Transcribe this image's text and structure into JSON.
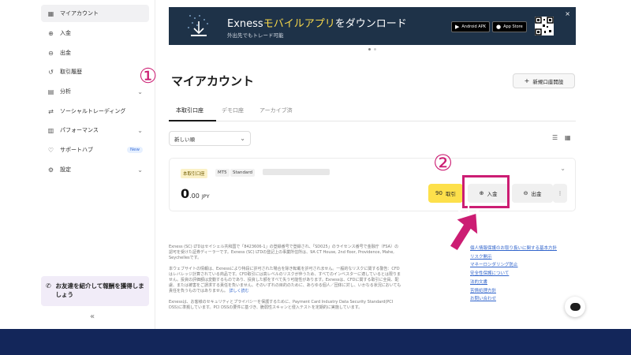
{
  "sidebar": {
    "items": [
      {
        "label": "マイアカウント",
        "icon": "grid-icon"
      },
      {
        "label": "入金",
        "icon": "plus-circle-icon"
      },
      {
        "label": "出金",
        "icon": "minus-circle-icon"
      },
      {
        "label": "取引履歴",
        "icon": "history-icon"
      },
      {
        "label": "分析",
        "icon": "analytics-icon"
      },
      {
        "label": "ソーシャルトレーディング",
        "icon": "social-icon"
      },
      {
        "label": "パフォーマンス",
        "icon": "chart-icon"
      },
      {
        "label": "サポートハブ",
        "icon": "heart-icon",
        "badge": "New"
      },
      {
        "label": "設定",
        "icon": "gear-icon"
      }
    ],
    "promo": "お友達を紹介して報酬を獲得しましょう",
    "collapse": "«"
  },
  "banner": {
    "title_brand": "Exness",
    "title_highlight": "モバイルアプリ",
    "title_rest": "をダウンロード",
    "subtitle": "外出先でもトレード可能",
    "android_label": "Android APK",
    "appstore_label": "App Store",
    "close": "×"
  },
  "markers": {
    "one": "①",
    "two": "②"
  },
  "header": {
    "title": "マイアカウント",
    "new_account_button": "新規口座開設"
  },
  "tabs": [
    {
      "label": "本取引口座"
    },
    {
      "label": "デモ口座"
    },
    {
      "label": "アーカイブ済"
    }
  ],
  "sort": {
    "selected": "新しい順"
  },
  "account": {
    "badges": [
      "本取引口座",
      "MT5",
      "Standard"
    ],
    "balance_int": "0",
    "balance_dec": ".00",
    "currency": "JPY",
    "trade_button": "取引",
    "trade_icon": "90",
    "deposit_button": "入金",
    "withdraw_button": "出金",
    "more": "⋮"
  },
  "disclaimer": {
    "p1": "Exness (SC) LTDはセイシェル共和国で「8423606-1」の登録番号で登録され、「SD025」のライセンス番号で金融庁（FSA）の認可を受けた証券ディーラーです。Exness (SC) LTDの登記上の事業所住所は、9A CT House, 2nd floor, Providence, Mahe, Seychellesです。",
    "p2": "本ウェブサイトの情報は、Exnessにより特段に許可された場合を除き転載を許可されません。一般的なリスクに関する警告：CFDはレバレッジ計算されている商品です。CFD取引には高レベルのリスクが伴うため、すべてのインベスターに適しているとは限りません。投資の評価額は変動するものであり、投資した額をすべて失う可能性があります。Exnessは、CFDに関する取引に全員、配慮、または被害をご請求する責任を負いません。そのいずれの目的のために、あらゆる個人／団体に対し、いかなる状況においても責任を負うものではありません。",
    "p2_link": "詳しく読む",
    "p3": "Exnessは、お客様のセキュリティとプライバシーを保護するために、Payment Card Industry Data Security Standard(PCI DSS)に準拠しています。PCI DSSの要件に基づき、脆弱性スキャンと侵入テストを定期的に実施しています。"
  },
  "legal_links": [
    "個人情報保護のお取り扱いに関する基本方針",
    "リスク開示",
    "マネーロンダリング防止",
    "安全性保護について",
    "法的文書",
    "苦情処理方針",
    "お問い合わせ"
  ],
  "colors": {
    "accent": "#cc1d73",
    "banner_bg": "#1e3248",
    "trade_yellow": "#fde04b",
    "footer_band": "#13265a"
  }
}
